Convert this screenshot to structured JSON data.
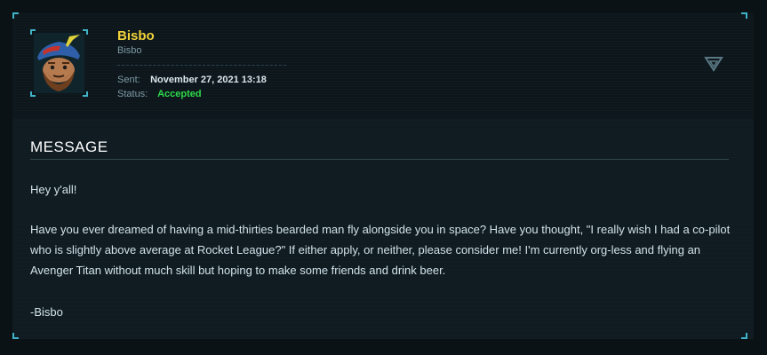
{
  "profile": {
    "name": "Bisbo",
    "handle": "Bisbo",
    "sent_label": "Sent:",
    "sent_value": "November 27, 2021 13:18",
    "status_label": "Status:",
    "status_value": "Accepted"
  },
  "colors": {
    "accent": "#3fb3c8",
    "name": "#f0d23a",
    "status_accepted": "#2fd94b"
  },
  "icons": {
    "collapse": "chevron-down-icon",
    "avatar": "avatar-pirate-icon"
  },
  "message": {
    "title": "MESSAGE",
    "paragraphs": [
      "Hey y'all!",
      "Have you ever dreamed of having a mid-thirties bearded man fly alongside you in space? Have you thought, \"I really wish I had a co-pilot who is slightly above average at Rocket League?\" If either apply, or neither, please consider me! I'm currently org-less and flying an Avenger Titan without much skill but hoping to make some friends and drink beer.",
      "-Bisbo"
    ]
  }
}
